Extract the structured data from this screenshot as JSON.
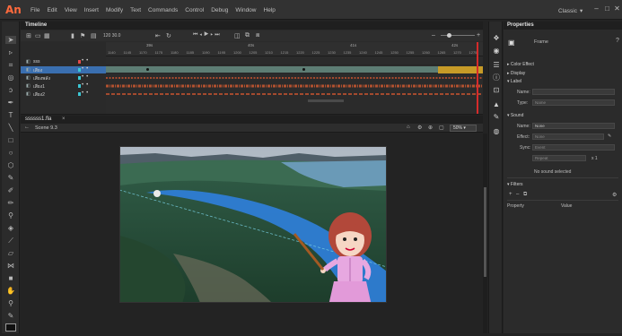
{
  "app": {
    "logo": "An",
    "workspace": "Classic"
  },
  "menu": [
    "File",
    "Edit",
    "View",
    "Insert",
    "Modify",
    "Text",
    "Commands",
    "Control",
    "Debug",
    "Window",
    "Help"
  ],
  "window_controls": [
    "–",
    "□",
    "✕"
  ],
  "timeline": {
    "tab_label": "Timeline",
    "fps": "120 30.0",
    "seconds": [
      "39s",
      "40s",
      "41s",
      "42s"
    ],
    "frame_numbers": [
      "1140",
      "1145",
      "1170",
      "1175",
      "1180",
      "1185",
      "1190",
      "1195",
      "1200",
      "1205",
      "1210",
      "1215",
      "1220",
      "1225",
      "1230",
      "1235",
      "1240",
      "1245",
      "1250",
      "1255",
      "1260",
      "1265",
      "1270",
      "1275"
    ],
    "layers": [
      {
        "name": "sss",
        "color": "#e04a4a"
      },
      {
        "name": "เสียง",
        "color": "#3cc7d4",
        "selected": true
      },
      {
        "name": "เสียงพลัง",
        "color": "#3cc7d4"
      },
      {
        "name": "เสียง1",
        "color": "#3cc7d4"
      },
      {
        "name": "เสียง2",
        "color": "#3cc7d4"
      }
    ],
    "current_frame_marker": "1265"
  },
  "document": {
    "tab_label": "ssssss1.fla",
    "scene_label": "Scene 9.3",
    "zoom": "50%"
  },
  "properties": {
    "tab_label": "Properties",
    "object_type": "Frame",
    "sections": {
      "color_effect": "Color Effect",
      "display": "Display",
      "label": "Label",
      "sound": "Sound",
      "filters": "Filters"
    },
    "label_name_label": "Name:",
    "label_type_label": "Type:",
    "label_type_value": "Name",
    "sound_name_label": "Name:",
    "sound_name_value": "None",
    "sound_effect_label": "Effect:",
    "sound_effect_value": "None",
    "sound_sync_label": "Sync:",
    "sound_sync_value": "Event",
    "sound_repeat_value": "Repeat",
    "sound_repeat_count": "x 1",
    "no_sound_text": "No sound selected",
    "filters_columns": [
      "Property",
      "Value"
    ]
  }
}
